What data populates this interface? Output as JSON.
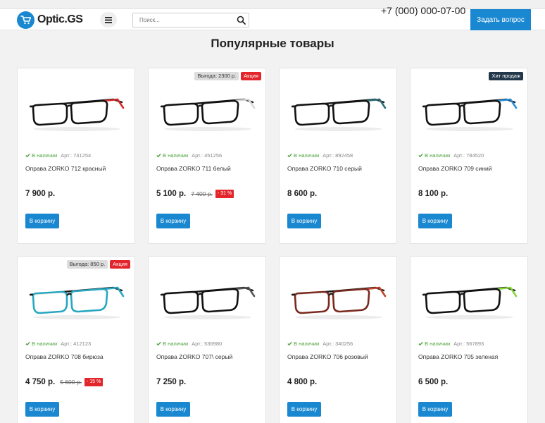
{
  "header": {
    "logo_text": "Optic.GS",
    "search_placeholder": "Поиск...",
    "phone": "+7 (000) 000-07-00",
    "ask_button": "Задать вопрос"
  },
  "section_title": "Популярные товары",
  "colors": {
    "accent": "#1a88d0",
    "sale": "#e3262b",
    "stock": "#4ba03a",
    "hit": "#22384a"
  },
  "products": [
    {
      "name": "Оправа ZORKO 712 красный",
      "stock": "В наличии",
      "article": "Арт.: 741254",
      "price": "7 900 р.",
      "old_price": "",
      "discount": "",
      "savings": "",
      "badge": "",
      "cart": "В корзину",
      "accent_color": "#d62a2a"
    },
    {
      "name": "Оправа ZORKO 711 белый",
      "stock": "В наличии",
      "article": "Арт.: 451256",
      "price": "5 100 р.",
      "old_price": "7 400 р.",
      "discount": "- 31 %",
      "savings": "Выгода: 2300 р.",
      "badge": "Акция",
      "cart": "В корзину",
      "accent_color": "#d8d8d8"
    },
    {
      "name": "Оправа ZORKO 710 серый",
      "stock": "В наличии",
      "article": "Арт.: 892458",
      "price": "8 600 р.",
      "old_price": "",
      "discount": "",
      "savings": "",
      "badge": "",
      "cart": "В корзину",
      "accent_color": "#2f6f78"
    },
    {
      "name": "Оправа ZORKO 709 синий",
      "stock": "В наличии",
      "article": "Арт.: 784520",
      "price": "8 100 р.",
      "old_price": "",
      "discount": "",
      "savings": "",
      "badge": "Хит продаж",
      "cart": "В корзину",
      "accent_color": "#2a8fd8"
    },
    {
      "name": "Оправа ZORKO 708 бирюза",
      "stock": "В наличии",
      "article": "Арт.: 412123",
      "price": "4 750 р.",
      "old_price": "5 600 р.",
      "discount": "- 15 %",
      "savings": "Выгода: 850 р.",
      "badge": "Акция",
      "cart": "В корзину",
      "accent_color": "#28a7c0"
    },
    {
      "name": "Оправа ZORKO 707\\ серый",
      "stock": "В наличии",
      "article": "Арт.: 536980",
      "price": "7 250 р.",
      "old_price": "",
      "discount": "",
      "savings": "",
      "badge": "",
      "cart": "В корзину",
      "accent_color": "#555555"
    },
    {
      "name": "Оправа ZORKO 706 розовый",
      "stock": "В наличии",
      "article": "Арт.: 340256",
      "price": "4 800 р.",
      "old_price": "",
      "discount": "",
      "savings": "",
      "badge": "",
      "cart": "В корзину",
      "accent_color": "#c2452f"
    },
    {
      "name": "Оправа ZORKO 705 зеленая",
      "stock": "В наличии",
      "article": "Арт.: 567893",
      "price": "6 500 р.",
      "old_price": "",
      "discount": "",
      "savings": "",
      "badge": "",
      "cart": "В корзину",
      "accent_color": "#86d83a"
    }
  ]
}
